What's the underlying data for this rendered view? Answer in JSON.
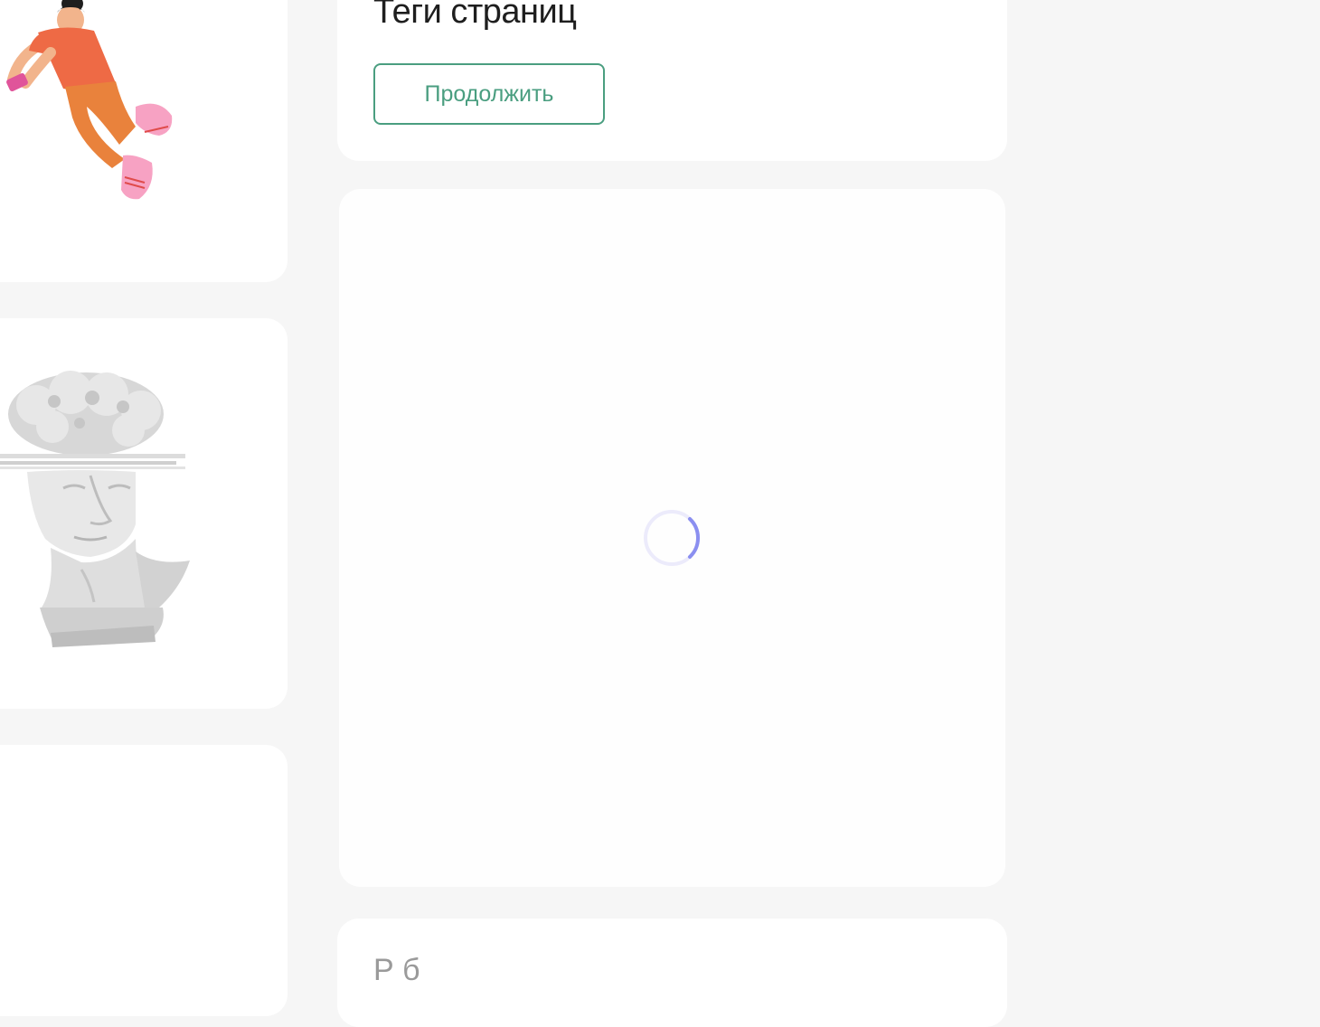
{
  "section": {
    "title": "Теги страниц",
    "continue_label": "Продолжить"
  },
  "footer_card": {
    "partial_text": "Р    б"
  },
  "loader": {
    "state": "loading",
    "accent_color": "#8b8ff0"
  },
  "colors": {
    "background": "#f6f6f6",
    "card": "#ffffff",
    "accent_green": "#4a9e80"
  },
  "illustrations": {
    "top_left": "person-with-phone-illustration",
    "middle_left": "david-bust-illustration"
  }
}
